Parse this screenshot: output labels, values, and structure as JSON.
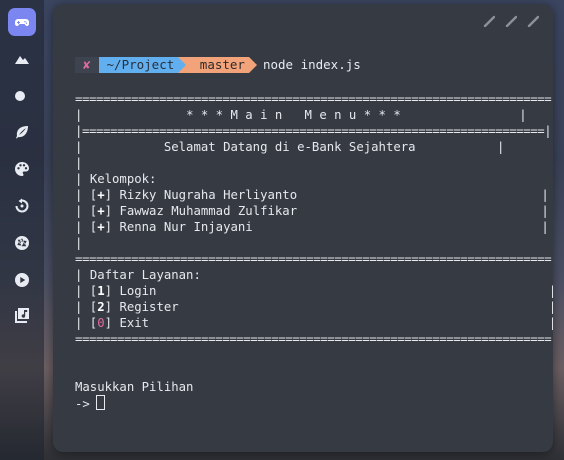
{
  "dock": {
    "icons": [
      "gamepad-icon",
      "mountain-icon",
      "toggle-icon",
      "leaf-icon",
      "palette-icon",
      "history-icon",
      "aperture-icon",
      "play-icon",
      "music-library-icon"
    ]
  },
  "terminal": {
    "prompt": {
      "status_symbol": "✘",
      "directory": "~/Project",
      "branch_symbol": "",
      "branch": "master",
      "command": "node index.js"
    },
    "rule_double": "====================================================================",
    "rule_inner": "==================================================================",
    "menu_title": "* * * M a i n   M e n u * * *",
    "welcome": "Selamat Datang di e-Bank Sejahtera",
    "group_heading": "Kelompok:",
    "members": [
      "Rizky Nugraha Herliyanto",
      "Fawwaz Muhammad Zulfikar",
      "Renna Nur Injayani"
    ],
    "member_marker": "+",
    "services_heading": "Daftar Layanan:",
    "services": [
      {
        "key": "1",
        "label": "Login"
      },
      {
        "key": "2",
        "label": "Register"
      },
      {
        "key": "0",
        "label": "Exit"
      }
    ],
    "input_prompt": "Masukkan Pilihan",
    "input_arrow": "->"
  },
  "colors": {
    "accent": "#7b86f0",
    "terminal_bg": "#353a43",
    "dir_segment": "#61afef",
    "branch_segment": "#f2a37a",
    "error_pink": "#e06c9f"
  }
}
